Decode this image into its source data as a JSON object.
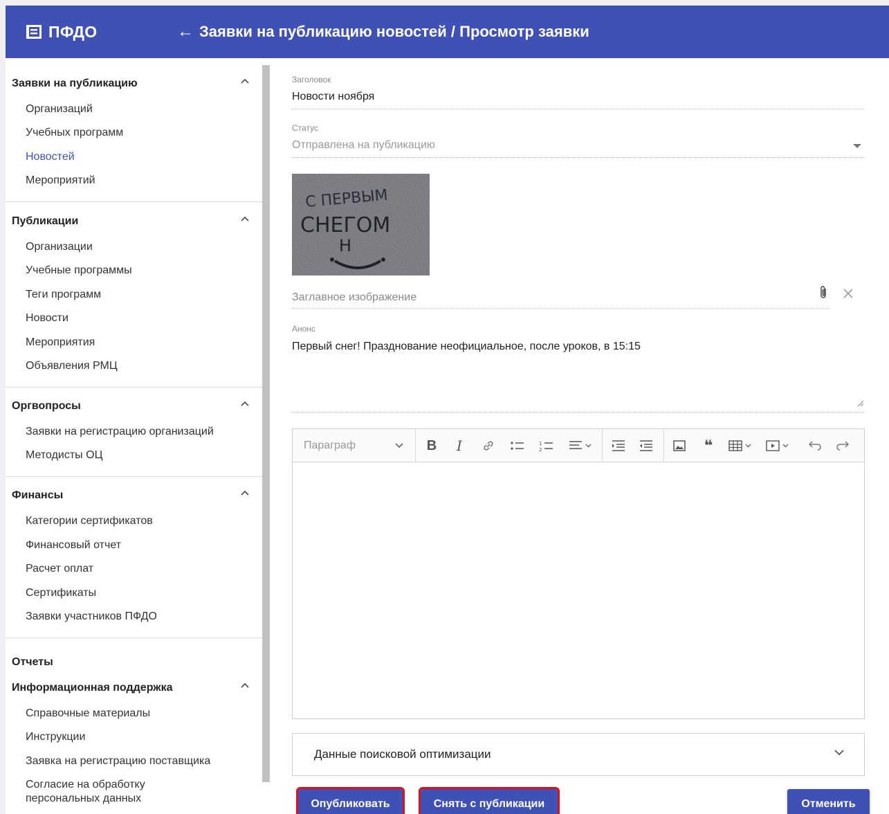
{
  "header": {
    "brand": "ПФДО",
    "breadcrumb": "Заявки на публикацию новостей / Просмотр заявки"
  },
  "sidebar": {
    "sections": [
      {
        "title": "Заявки на публикацию",
        "items": [
          "Организаций",
          "Учебных программ",
          "Новостей",
          "Мероприятий"
        ],
        "active_item": "Новостей"
      },
      {
        "title": "Публикации",
        "items": [
          "Организации",
          "Учебные программы",
          "Теги программ",
          "Новости",
          "Мероприятия",
          "Объявления РМЦ"
        ]
      },
      {
        "title": "Оргвопросы",
        "items": [
          "Заявки на регистрацию организаций",
          "Методисты ОЦ"
        ]
      },
      {
        "title": "Финансы",
        "items": [
          "Категории сертификатов",
          "Финансовый отчет",
          "Расчет оплат",
          "Сертификаты",
          "Заявки участников ПФДО"
        ]
      },
      {
        "title": "Отчеты",
        "items": []
      },
      {
        "title": "Информационная поддержка",
        "items": [
          "Справочные материалы",
          "Инструкции",
          "Заявка на регистрацию поставщика",
          "Согласие на обработку персональных данных"
        ]
      }
    ]
  },
  "form": {
    "title_label": "Заголовок",
    "title_value": "Новости ноября",
    "status_label": "Статус",
    "status_value": "Отправлена на публикацию",
    "image_caption": "Заглавное изображение",
    "image_text_line1": "С ПЕРВЫМ",
    "image_text_line2": "СНЕГОМ",
    "image_text_line3": "Н",
    "announce_label": "Анонс",
    "announce_value": "Первый снег! Празднование неофициальное, после уроков, в 15:15"
  },
  "editor": {
    "paragraph_select": "Параграф",
    "toolbar_icons": [
      "bold-icon",
      "italic-icon",
      "link-icon",
      "bulleted-list-icon",
      "numbered-list-icon",
      "align-icon",
      "indent-icon",
      "outdent-icon",
      "image-icon",
      "quote-icon",
      "table-icon",
      "media-icon",
      "undo-icon",
      "redo-icon"
    ]
  },
  "seo": {
    "label": "Данные поисковой оптимизации"
  },
  "actions": {
    "publish": "Опубликовать",
    "unpublish": "Снять с публикации",
    "cancel": "Отменить"
  },
  "colors": {
    "primary": "#3f51b5",
    "highlight": "#e0101a",
    "active_nav": "#3f51b5"
  }
}
